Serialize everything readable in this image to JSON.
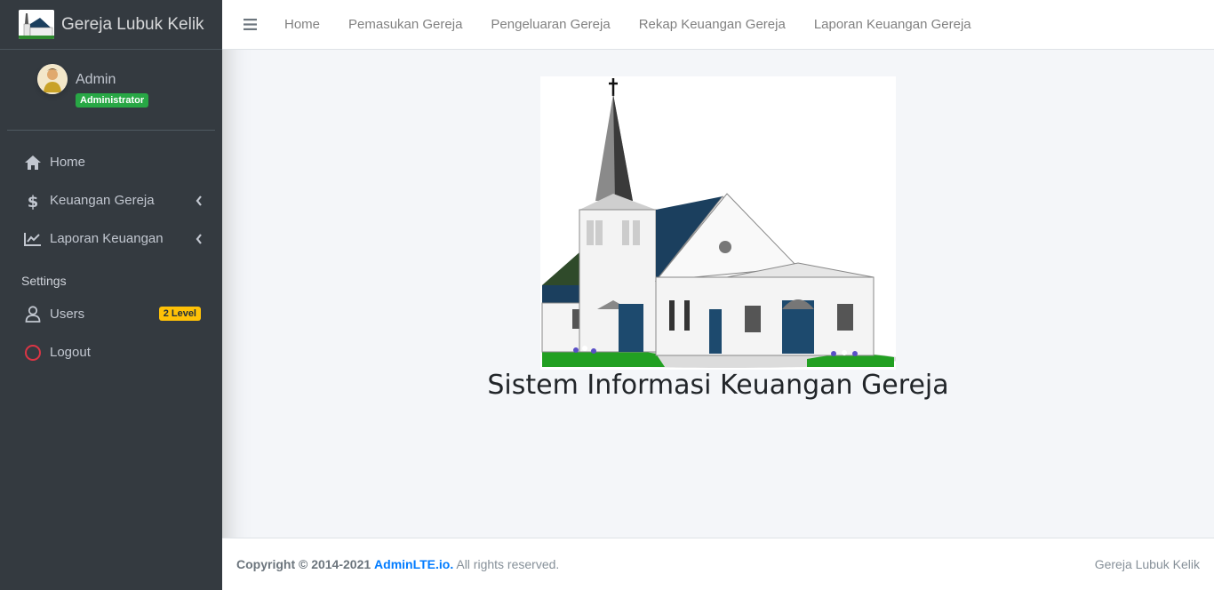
{
  "brand": {
    "name": "Gereja Lubuk Kelik"
  },
  "user": {
    "name": "Admin",
    "role_badge": "Administrator"
  },
  "sidebar": {
    "items": [
      {
        "label": "Home",
        "icon": "home-icon"
      },
      {
        "label": "Keuangan Gereja",
        "icon": "dollar-icon",
        "has_submenu": true
      },
      {
        "label": "Laporan Keuangan",
        "icon": "chart-line-icon",
        "has_submenu": true
      }
    ],
    "settings_header": "Settings",
    "settings_items": [
      {
        "label": "Users",
        "icon": "user-icon",
        "badge": "2 Level"
      },
      {
        "label": "Logout",
        "icon": "circle-icon"
      }
    ]
  },
  "topnav": {
    "links": [
      "Home",
      "Pemasukan Gereja",
      "Pengeluaran Gereja",
      "Rekap Keuangan Gereja",
      "Laporan Keuangan Gereja"
    ]
  },
  "main": {
    "title": "Sistem Informasi Keuangan Gereja"
  },
  "footer": {
    "copyright_prefix": "Copyright © 2014-2021",
    "link_text": "AdminLTE.io.",
    "suffix": "All rights reserved.",
    "right_text": "Gereja Lubuk Kelik"
  },
  "colors": {
    "sidebar_bg": "#343a40",
    "badge_admin": "#28a745",
    "badge_level": "#ffc107",
    "link": "#007bff",
    "logout_icon": "#dc3545"
  }
}
